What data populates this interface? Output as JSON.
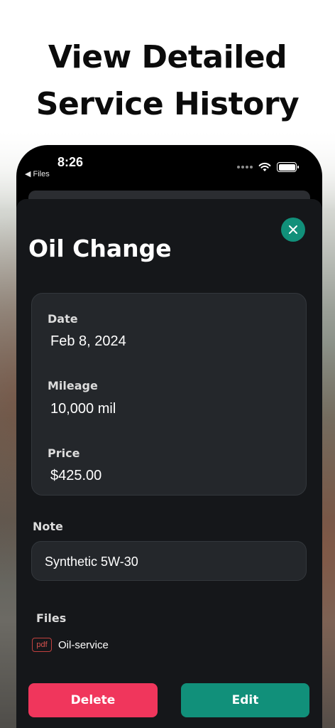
{
  "headline": {
    "line1": "View Detailed",
    "line2": "Service History"
  },
  "status_bar": {
    "time": "8:26",
    "back_label": "◀ Files",
    "icons": [
      "signal-dots-icon",
      "wifi-icon",
      "battery-icon"
    ],
    "battery_level": 1.0
  },
  "record": {
    "title": "Oil Change",
    "date_label": "Date",
    "date_value": "Feb 8, 2024",
    "mileage_label": "Mileage",
    "mileage_value": "10,000 mil",
    "price_label": "Price",
    "price_value": "$425.00",
    "note_label": "Note",
    "note_value": "Synthetic 5W-30",
    "files_label": "Files",
    "files": [
      {
        "type": "pdf",
        "name": "Oil-service"
      }
    ]
  },
  "actions": {
    "delete_label": "Delete",
    "edit_label": "Edit"
  },
  "colors": {
    "accent": "#11907a",
    "danger": "#f0365c",
    "sheet_bg": "#15171a",
    "card_bg": "#24272b"
  }
}
